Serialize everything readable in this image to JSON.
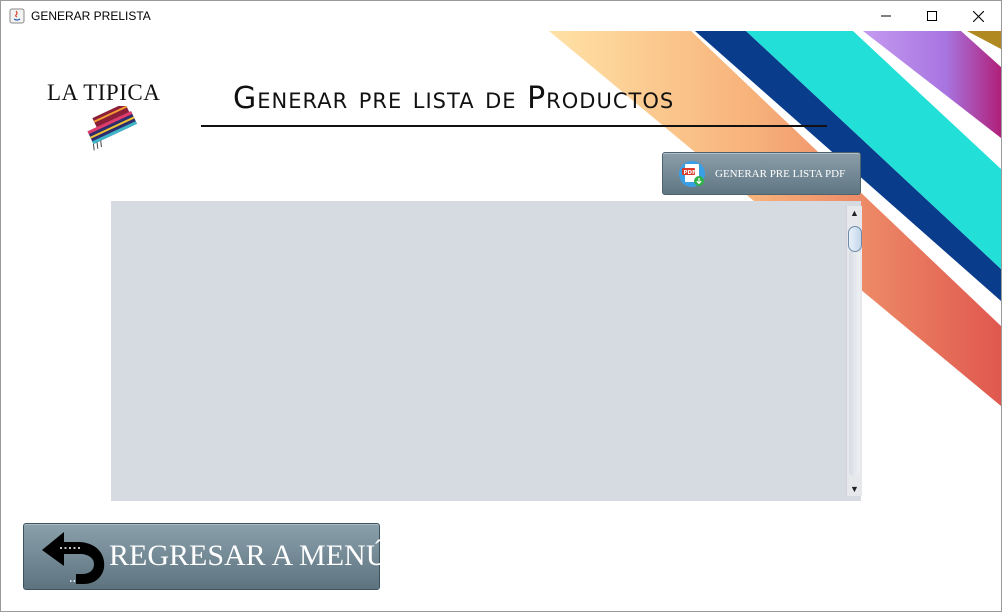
{
  "window": {
    "title": "GENERAR PRELISTA",
    "controls": {
      "minimize": "minimize-icon",
      "maximize": "maximize-icon",
      "close": "close-icon"
    }
  },
  "header": {
    "logo_text": "LA TIPICA",
    "page_title": "Generar pre lista de Productos"
  },
  "actions": {
    "pdf_button_label": "GENERAR PRE LISTA PDF",
    "back_button_label": "REGRESAR A MENÚ"
  },
  "icons": {
    "pdf": "pdf-download-icon",
    "back": "back-arrow-icon",
    "logo": "scarf-logo-icon"
  },
  "colors": {
    "list_background": "#d6dae1",
    "button_top": "#8a9ea9",
    "button_bottom": "#5f7683",
    "stripe_orange": "#f7b27a",
    "stripe_red": "#e0584f",
    "stripe_navy": "#0a3c8c",
    "stripe_cyan": "#22e0d8",
    "stripe_purple": "#a875e0",
    "stripe_magenta": "#b0207a"
  }
}
